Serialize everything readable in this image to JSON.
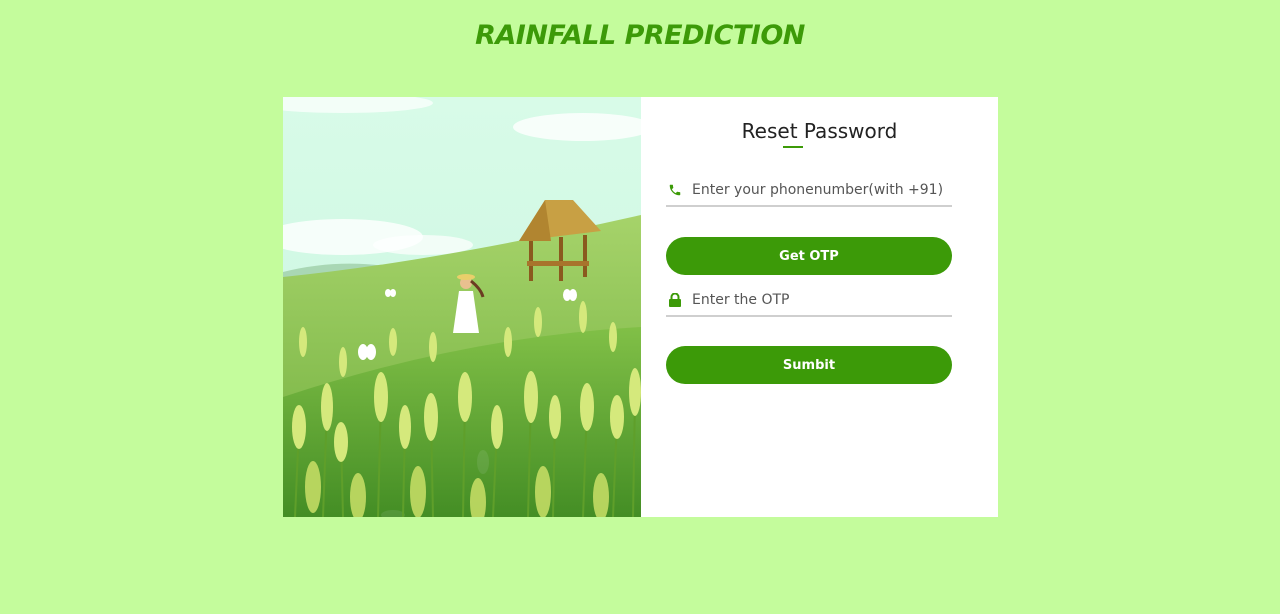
{
  "app": {
    "title": "RAINFALL PREDICTION"
  },
  "form": {
    "title": "Reset Password",
    "phone_placeholder": "Enter your phonenumber(with +91)",
    "get_otp_label": "Get OTP",
    "otp_placeholder": "Enter the OTP",
    "submit_label": "Sumbit"
  },
  "colors": {
    "background": "#c4fc9c",
    "accent": "#3c9a08"
  },
  "icons": {
    "phone": "phone-icon",
    "lock": "lock-icon"
  }
}
